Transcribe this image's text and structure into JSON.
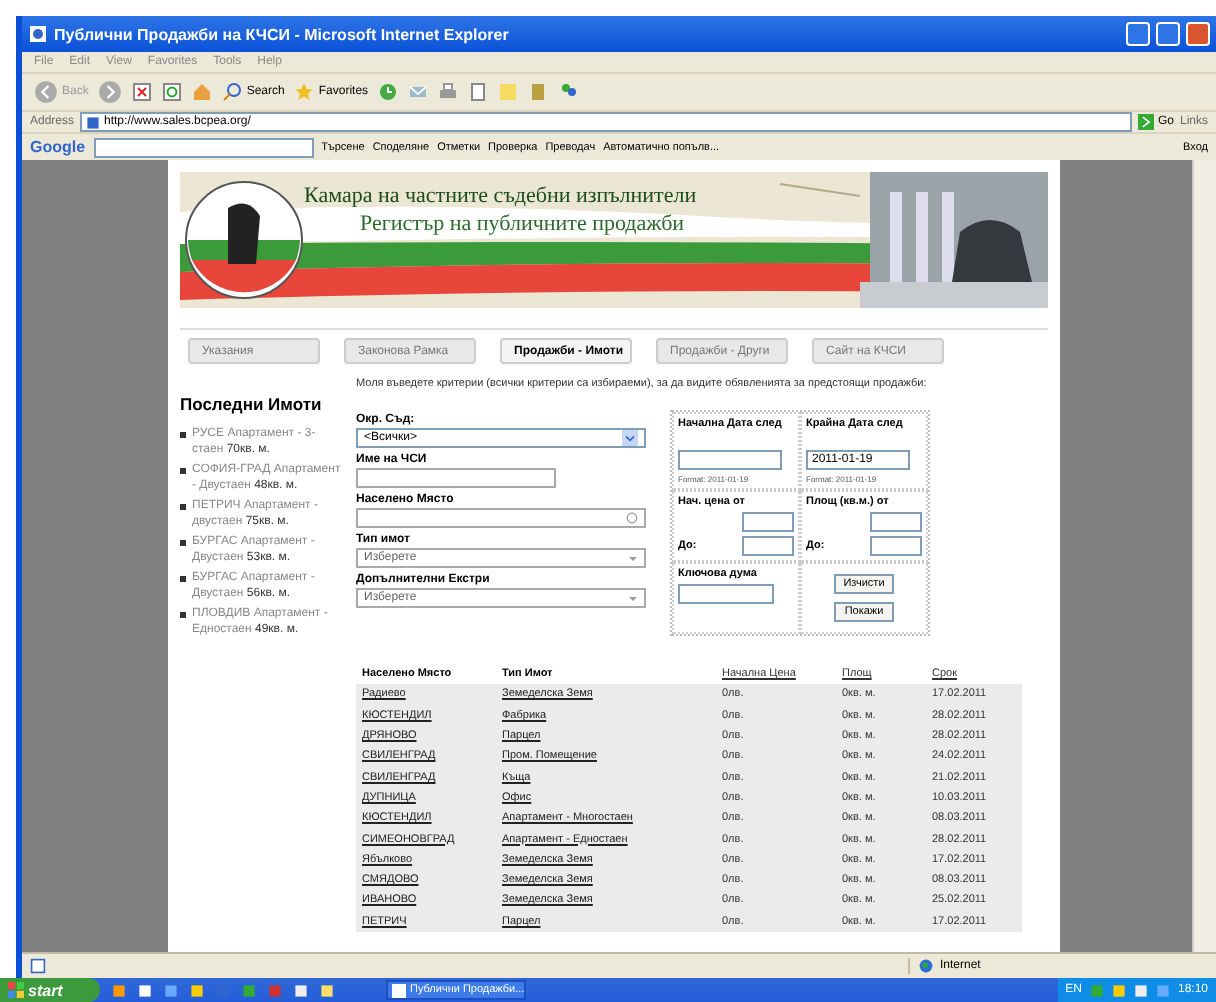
{
  "window": {
    "title": "Публични Продажби на КЧСИ - Microsoft Internet Explorer"
  },
  "menu": [
    "File",
    "Edit",
    "View",
    "Favorites",
    "Tools",
    "Help"
  ],
  "toolbar": [
    {
      "kind": "back",
      "label": "Back"
    },
    {
      "kind": "forward"
    },
    {
      "kind": "stop"
    },
    {
      "kind": "refresh"
    },
    {
      "kind": "home"
    },
    {
      "kind": "search",
      "label": "Search"
    },
    {
      "kind": "favorites",
      "label": "Favorites"
    },
    {
      "kind": "history"
    },
    {
      "kind": "mail"
    },
    {
      "kind": "print"
    },
    {
      "kind": "edit"
    },
    {
      "kind": "note"
    },
    {
      "kind": "research"
    },
    {
      "kind": "messenger"
    }
  ],
  "address": {
    "label": "Address",
    "url": "http://www.sales.bcpea.org/",
    "go": "Go",
    "links": "Links"
  },
  "google_bar": {
    "logo": "Google",
    "items": [
      "Търсене",
      "Споделяне",
      "Отметки",
      "Проверка",
      "Преводач",
      "Автоматично попълв..."
    ],
    "signin": "Вход"
  },
  "page": {
    "banner": {
      "title": "Камара на частните съдебни изпълнители",
      "subtitle": "Регистър на публичните продажби"
    },
    "nav": [
      {
        "label": "Указания",
        "selected": false
      },
      {
        "label": "Законова Рамка",
        "selected": false
      },
      {
        "label": "Продажби - Имоти",
        "selected": true
      },
      {
        "label": "Продажби - Други",
        "selected": false
      },
      {
        "label": "Сайт на КЧСИ",
        "selected": false
      }
    ],
    "intro": "Моля въведете критерии (всички критерии са избираеми), за да видите обявленията за предстоящи продажби:",
    "sidebar": {
      "title": "Последни Имоти",
      "items": [
        {
          "place": "РУСЕ",
          "desc": "Апартамент - 3-стаен",
          "area": "70кв. м."
        },
        {
          "place": "СОФИЯ-ГРАД",
          "desc": "Апартамент - Двустаен",
          "area": "48кв. м."
        },
        {
          "place": "ПЕТРИЧ",
          "desc": "Апартамент - двустаен",
          "area": "75кв. м."
        },
        {
          "place": "БУРГАС",
          "desc": "Апартамент - Двустаен",
          "area": "53кв. м."
        },
        {
          "place": "БУРГАС",
          "desc": "Апартамент - Двустаен",
          "area": "56кв. м."
        },
        {
          "place": "ПЛОВДИВ",
          "desc": "Апартамент - Едностаен",
          "area": "49кв. м."
        }
      ]
    },
    "form": [
      {
        "kind": "select",
        "label": "Окр. Съд:",
        "value": "<Всички>"
      },
      {
        "kind": "text",
        "label": "Име на ЧСИ"
      },
      {
        "kind": "search",
        "label": "Населено Място"
      },
      {
        "kind": "combo",
        "label": "Тип имот",
        "value": "Изберете"
      },
      {
        "kind": "combo",
        "label": "Допълнителни Екстри",
        "value": "Изберете"
      }
    ],
    "dates": {
      "start_label": "Начална Дата след",
      "start_format": "Format: 2011-01-19",
      "end_label": "Крайна Дата след",
      "end_value": "2011-01-19",
      "end_format": "Format: 2011-01-19",
      "price_label": "Нач. цена от",
      "area_label": "Площ (кв.м.) от",
      "to_label_1": "До:",
      "to_label_2": "До:",
      "keyword_label": "Ключова дума",
      "buttons": [
        "Изчисти",
        "Покажи"
      ]
    },
    "table": {
      "columns": [
        {
          "label": "Населено Място",
          "sortable": false
        },
        {
          "label": "Тип Имот",
          "sortable": false
        },
        {
          "label": "Начална Цена",
          "sortable": true
        },
        {
          "label": "Площ",
          "sortable": true
        },
        {
          "label": "Срок",
          "sortable": true
        }
      ],
      "rows": [
        [
          "Радиево",
          "Земеделска Земя",
          "0лв.",
          "0кв. м.",
          "17.02.2011"
        ],
        [
          "КЮСТЕНДИЛ",
          "Фабрика",
          "0лв.",
          "0кв. м.",
          "28.02.2011"
        ],
        [
          "ДРЯНОВО",
          "Парцел",
          "0лв.",
          "0кв. м.",
          "28.02.2011"
        ],
        [
          "СВИЛЕНГРАД",
          "Пром. Помещение",
          "0лв.",
          "0кв. м.",
          "24.02.2011"
        ],
        [
          "СВИЛЕНГРАД",
          "Къща",
          "0лв.",
          "0кв. м.",
          "21.02.2011"
        ],
        [
          "ДУПНИЦА",
          "Офис",
          "0лв.",
          "0кв. м.",
          "10.03.2011"
        ],
        [
          "КЮСТЕНДИЛ",
          "Апартамент - Многостаен",
          "0лв.",
          "0кв. м.",
          "08.03.2011"
        ],
        [
          "СИМЕОНОВГРАД",
          "Апартамент - Едностаен",
          "0лв.",
          "0кв. м.",
          "28.02.2011"
        ],
        [
          "Ябълково",
          "Земеделска Земя",
          "0лв.",
          "0кв. м.",
          "17.02.2011"
        ],
        [
          "СМЯДОВО",
          "Земеделска Земя",
          "0лв.",
          "0кв. м.",
          "08.03.2011"
        ],
        [
          "ИВАНОВО",
          "Земеделска Земя",
          "0лв.",
          "0кв. м.",
          "25.02.2011"
        ],
        [
          "ПЕТРИЧ",
          "Парцел",
          "0лв.",
          "0кв. м.",
          "17.02.2011"
        ]
      ]
    }
  },
  "status_bar": {
    "zone": "Internet"
  },
  "taskbar": {
    "start": "start",
    "task": "Публични Продажби...",
    "lang": "EN",
    "clock": "18:10"
  }
}
